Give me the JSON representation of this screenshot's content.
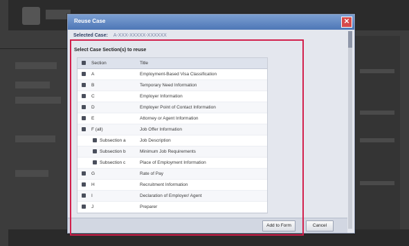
{
  "modal": {
    "title": "Reuse Case",
    "close_glyph": "✕",
    "selected_case_label": "Selected Case:",
    "selected_case_value": "A-XXX-XXXXX-XXXXXX",
    "instruction": "Select Case Section(s) to reuse"
  },
  "table": {
    "headers": {
      "section": "Section",
      "title": "Title"
    },
    "rows": [
      {
        "section": "A",
        "title": "Employment-Based Visa Classification",
        "indent": false
      },
      {
        "section": "B",
        "title": "Temporary Need Information",
        "indent": false
      },
      {
        "section": "C",
        "title": "Employer Information",
        "indent": false
      },
      {
        "section": "D",
        "title": "Employer Point of Contact Information",
        "indent": false
      },
      {
        "section": "E",
        "title": "Attorney or Agent Information",
        "indent": false
      },
      {
        "section": "F (all)",
        "title": "Job Offer Information",
        "indent": false
      },
      {
        "section": "Subsection a",
        "title": "Job Description",
        "indent": true
      },
      {
        "section": "Subsection b",
        "title": "Minimum Job Requirements",
        "indent": true
      },
      {
        "section": "Subsection c",
        "title": "Place of Employment Information",
        "indent": true
      },
      {
        "section": "G",
        "title": "Rate of Pay",
        "indent": false
      },
      {
        "section": "H",
        "title": "Recruitment Information",
        "indent": false
      },
      {
        "section": "I",
        "title": "Declaration of Employer/ Agent",
        "indent": false
      },
      {
        "section": "J",
        "title": "Preparer",
        "indent": false
      }
    ]
  },
  "footer": {
    "add_label": "Add to Form",
    "cancel_label": "Cancel"
  },
  "colors": {
    "highlight": "#d21f4b",
    "titlebar": "#4e77b6"
  }
}
